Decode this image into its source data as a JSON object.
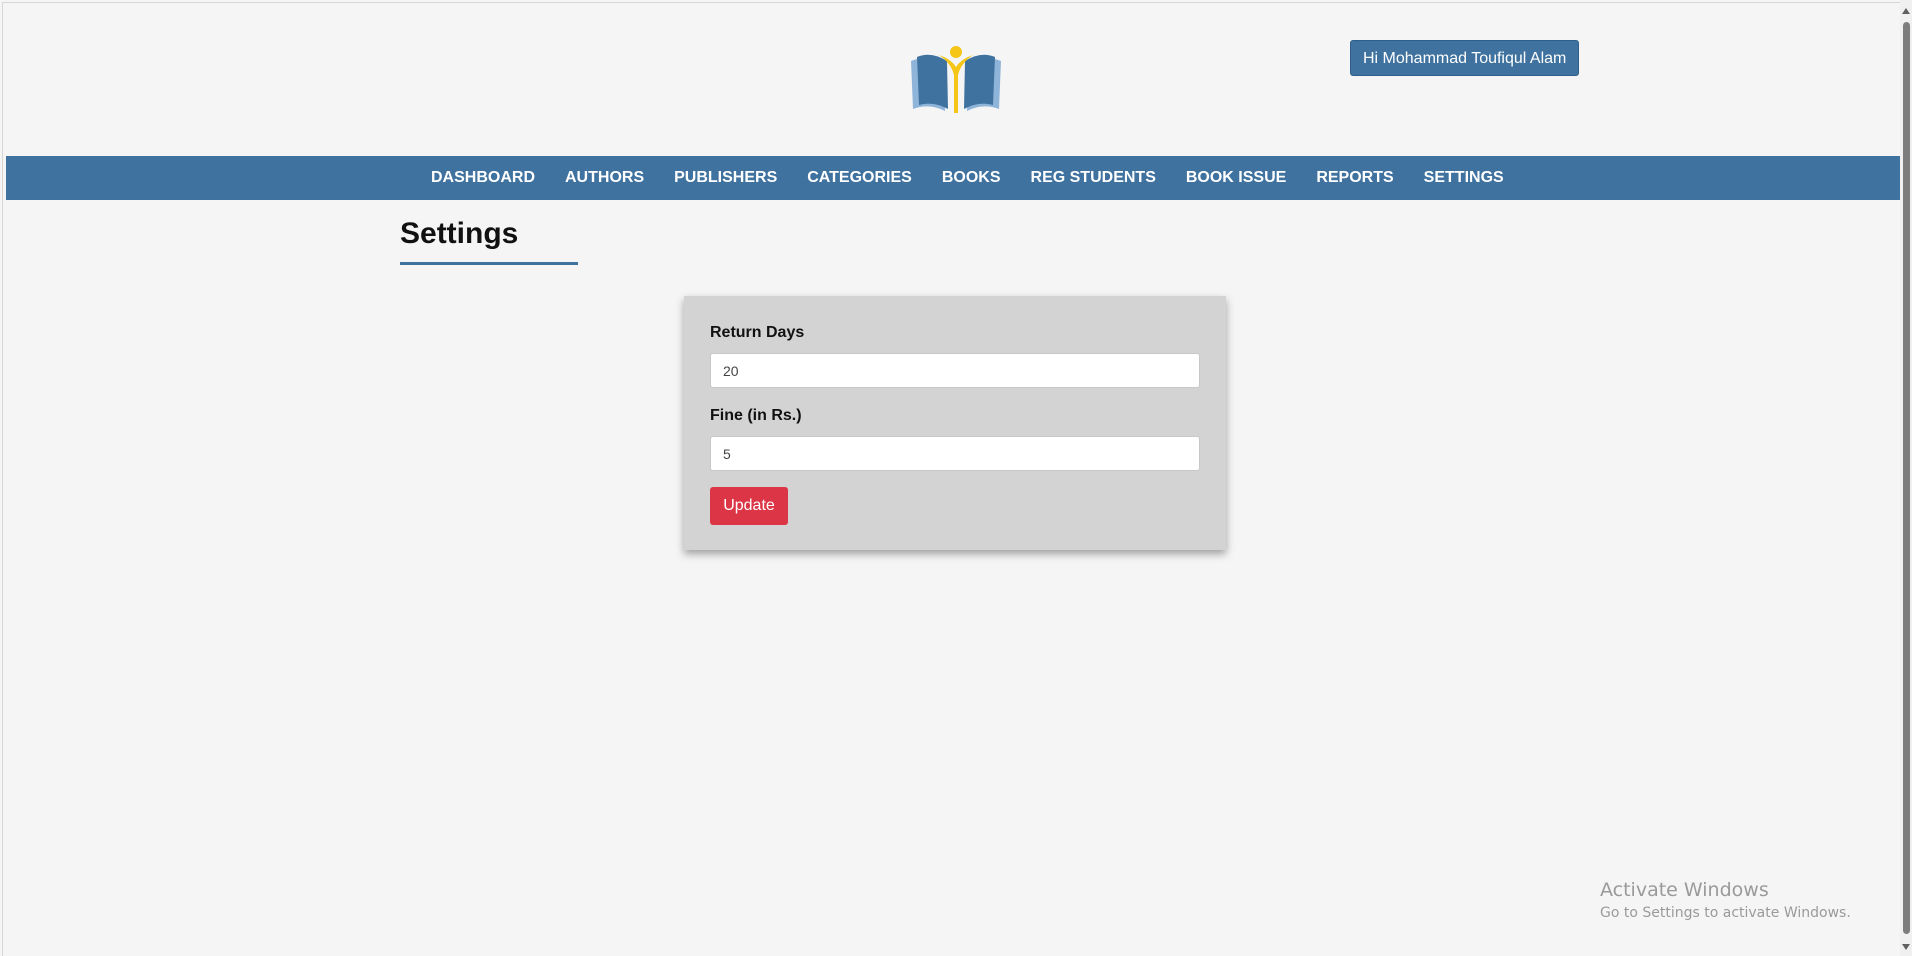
{
  "header": {
    "user_greeting": "Hi Mohammad Toufiqul Alam"
  },
  "nav": {
    "items": [
      {
        "label": "DASHBOARD"
      },
      {
        "label": "AUTHORS"
      },
      {
        "label": "PUBLISHERS"
      },
      {
        "label": "CATEGORIES"
      },
      {
        "label": "BOOKS"
      },
      {
        "label": "REG STUDENTS"
      },
      {
        "label": "BOOK ISSUE"
      },
      {
        "label": "REPORTS"
      },
      {
        "label": "SETTINGS"
      }
    ]
  },
  "page": {
    "title": "Settings"
  },
  "form": {
    "return_days_label": "Return Days",
    "return_days_value": "20",
    "fine_label": "Fine (in Rs.)",
    "fine_value": "5",
    "update_label": "Update"
  },
  "watermark": {
    "title": "Activate Windows",
    "subtitle": "Go to Settings to activate Windows."
  },
  "colors": {
    "brand_blue": "#3f729f",
    "update_red": "#dc3545",
    "card_gray": "#d3d3d3",
    "logo_yellow": "#f5c518"
  }
}
